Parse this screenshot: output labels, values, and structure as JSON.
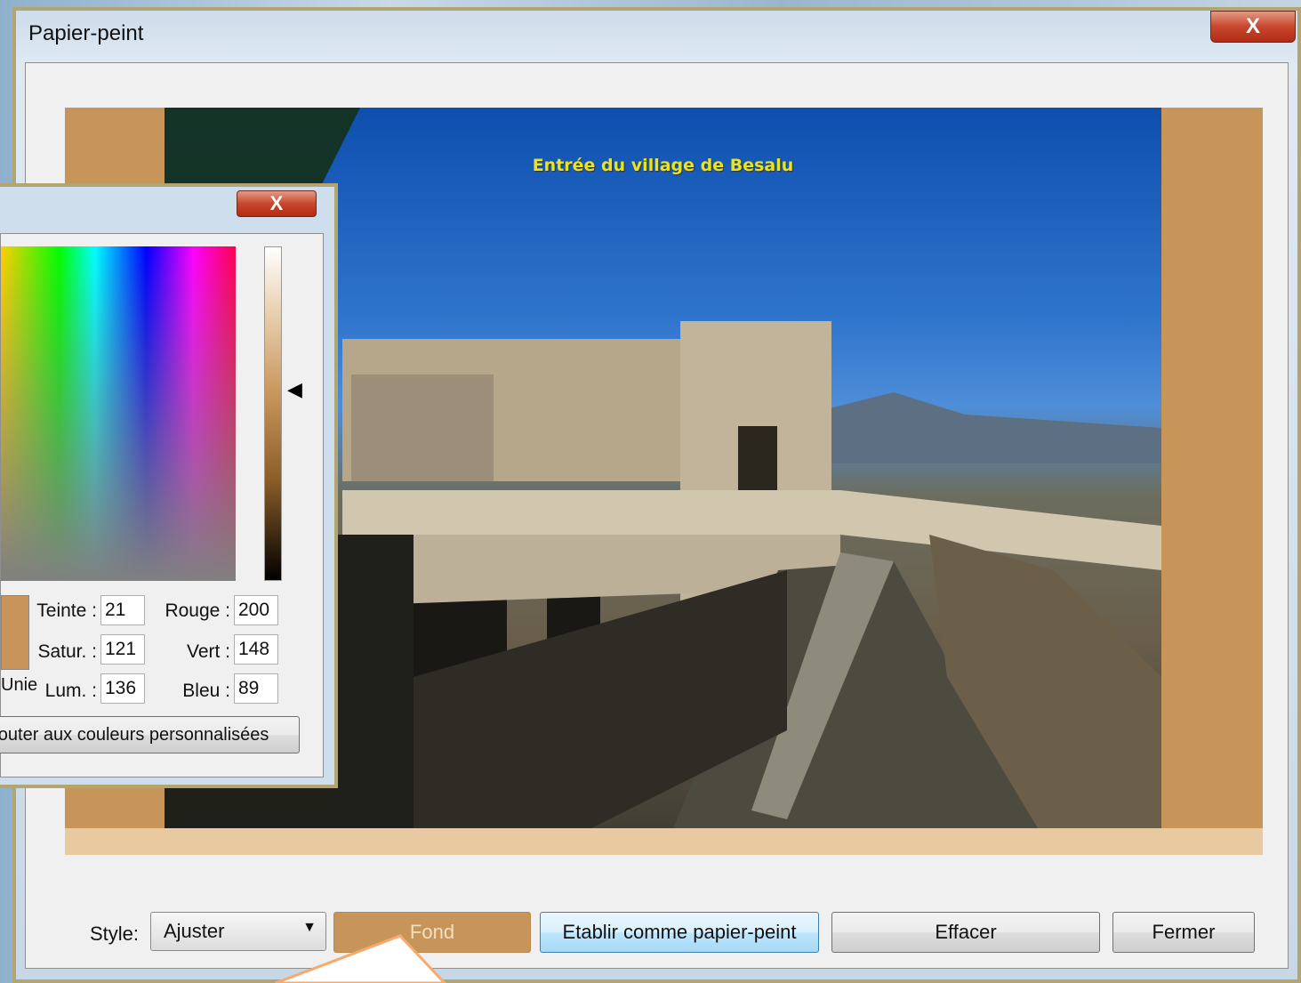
{
  "main_window": {
    "title": "Papier-peint",
    "close_glyph": "X",
    "preview": {
      "caption": "Entrée du village de Besalu",
      "background_color": "#c79459"
    },
    "bottom_bar": {
      "style_label": "Style:",
      "style_value": "Ajuster",
      "style_arrow": "▼",
      "fond_label": "Fond",
      "set_wallpaper_label": "Etablir comme papier-peint",
      "erase_label": "Effacer",
      "close_label": "Fermer"
    }
  },
  "color_dialog": {
    "close_glyph": "X",
    "pointer_glyph": "◀",
    "solid_label": "Unie",
    "fields": {
      "hue_label": "Teinte :",
      "hue_value": "21",
      "sat_label": "Satur. :",
      "sat_value": "121",
      "lum_label": "Lum. :",
      "lum_value": "136",
      "red_label": "Rouge :",
      "red_value": "200",
      "green_label": "Vert :",
      "green_value": "148",
      "blue_label": "Bleu :",
      "blue_value": "89"
    },
    "add_custom_label": "Ajouter aux couleurs personnalisées",
    "swatch_color": "#c89459"
  },
  "colors": {
    "window_frame": "#b3a572",
    "close_red": "#c8472e",
    "accent_selected": "#3c7fb1",
    "callout_orange": "#f7a96e"
  }
}
